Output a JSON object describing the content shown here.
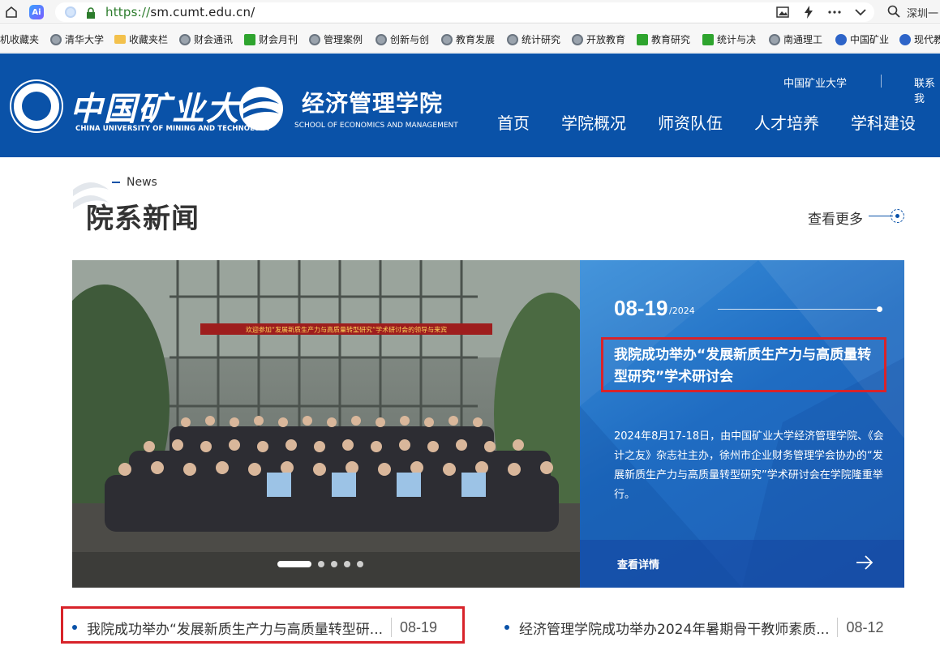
{
  "browser": {
    "url_scheme": "https://",
    "url_host": "sm.cumt.edu.cn/",
    "search_placeholder": "深圳一",
    "bookmarks": [
      {
        "label": "机收藏夹",
        "icon": "none"
      },
      {
        "label": "清华大学",
        "icon": "globe"
      },
      {
        "label": "收藏夹栏",
        "icon": "folder"
      },
      {
        "label": "财会通讯",
        "icon": "globe"
      },
      {
        "label": "财会月刊",
        "icon": "green"
      },
      {
        "label": "管理案例",
        "icon": "globe"
      },
      {
        "label": "创新与创",
        "icon": "globe"
      },
      {
        "label": "教育发展",
        "icon": "globe"
      },
      {
        "label": "统计研究",
        "icon": "globe"
      },
      {
        "label": "开放教育",
        "icon": "globe"
      },
      {
        "label": "教育研究",
        "icon": "green"
      },
      {
        "label": "统计与决",
        "icon": "green"
      },
      {
        "label": "南通理工",
        "icon": "globe"
      },
      {
        "label": "中国矿业",
        "icon": "blue"
      },
      {
        "label": "现代教",
        "icon": "blue"
      }
    ]
  },
  "header": {
    "univ_cn": "中国矿业大学",
    "univ_en": "CHINA UNIVERSITY OF MINING AND TECHNOLOGY",
    "school_cn": "经济管理学院",
    "school_en": "SCHOOL OF ECONOMICS AND MANAGEMENT",
    "top_links": [
      "中国矿业大学",
      "联系我"
    ],
    "nav": [
      "首页",
      "学院概况",
      "师资队伍",
      "人才培养",
      "学科建设"
    ]
  },
  "news": {
    "en_label": "News",
    "title": "院系新闻",
    "more": "查看更多"
  },
  "feature": {
    "date": "08-19",
    "year": "/2024",
    "title": "我院成功举办“发展新质生产力与高质量转型研究”学术研讨会",
    "body": "2024年8月17-18日，由中国矿业大学经济管理学院、《会计之友》杂志社主办，徐州市企业财务管理学会协办的“发展新质生产力与高质量转型研究”学术研讨会在学院隆重举行。",
    "detail": "查看详情",
    "banner": "欢迎参加“发展新质生产力与高质量转型研究”学术研讨会的领导与来宾",
    "slides_total": 5,
    "slide_active": 1
  },
  "list": [
    {
      "text": "我院成功举办“发展新质生产力与高质量转型研...",
      "date": "08-19"
    },
    {
      "text": "经济管理学院成功举办2024年暑期骨干教师素质...",
      "date": "08-12"
    }
  ],
  "colors": {
    "brand_blue": "#0a52a8",
    "highlight_red": "#d8232a"
  }
}
